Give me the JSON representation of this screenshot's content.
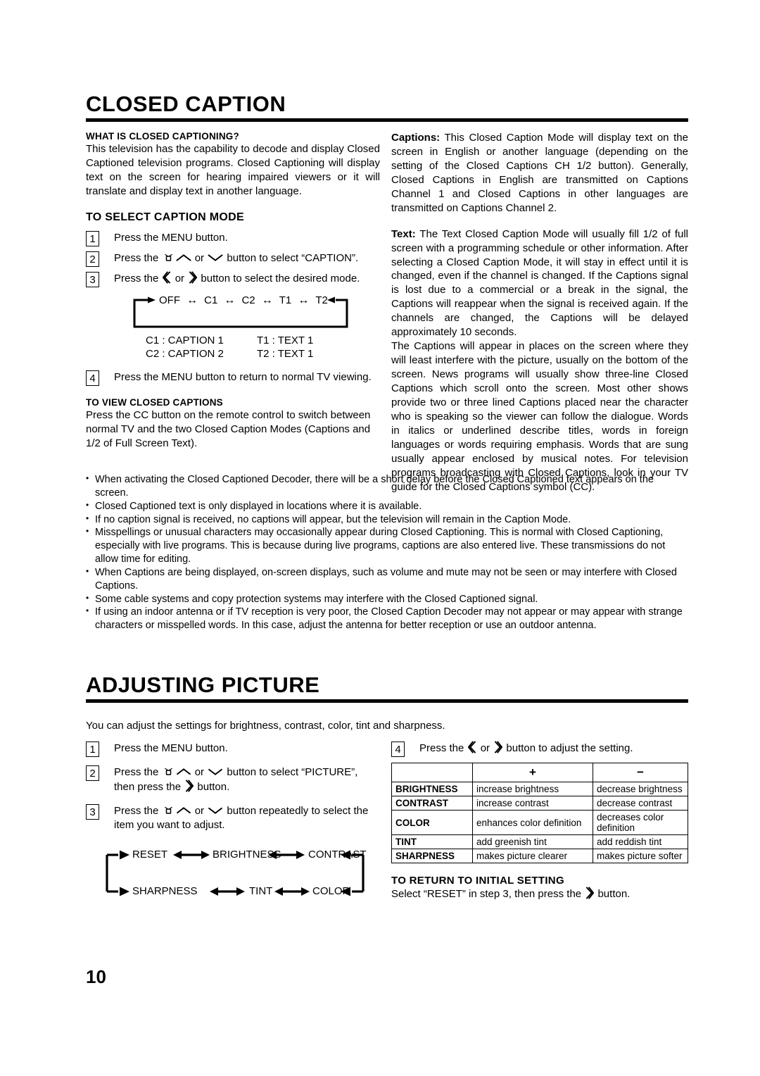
{
  "page": {
    "number": "10"
  },
  "closed_caption": {
    "title": "CLOSED CAPTION",
    "what_is": {
      "heading": "WHAT IS CLOSED CAPTIONING?",
      "body": "This television has the capability to decode and display Closed Captioned television programs. Closed Captioning will display text on the screen for hearing impaired viewers or it will translate and display text in another language."
    },
    "select_mode": {
      "heading": "TO SELECT CAPTION MODE",
      "steps": [
        {
          "num": "1",
          "text_before": "Press the MENU button.",
          "text_after": ""
        },
        {
          "num": "2",
          "text_before": "Press the ",
          "text_mid": " or ",
          "text_after": " button to select “CAPTION”."
        },
        {
          "num": "3",
          "text_before": "Press the ",
          "text_mid": " or ",
          "text_after": " button to select the desired mode."
        },
        {
          "num": "4",
          "text_before": "Press the MENU button to return to normal TV viewing.",
          "text_after": ""
        }
      ],
      "flow_items": [
        "OFF",
        "C1",
        "C2",
        "T1",
        "T2"
      ],
      "legend": [
        {
          "left": "C1  :  CAPTION 1",
          "right": "T1  :  TEXT 1"
        },
        {
          "left": "C2  :  CAPTION 2",
          "right": "T2  :  TEXT 1"
        }
      ]
    },
    "view_captions": {
      "heading": "TO VIEW CLOSED CAPTIONS",
      "body": "Press the CC button on the remote control to switch between normal TV and the two Closed Caption Modes (Captions and 1/2 of Full Screen Text)."
    },
    "captions_para": {
      "label": "Captions:",
      "body": " This Closed Caption Mode will display text on the screen in English or another language (depending on the setting of the Closed Captions CH 1/2 button). Generally, Closed Captions in English are transmitted on Captions Channel 1 and Closed Captions in other languages are transmitted on Captions Channel 2."
    },
    "text_para": {
      "label": "Text:",
      "body": " The Text Closed Caption Mode will usually fill 1/2 of full screen with a programming schedule or other information. After selecting a Closed Caption Mode, it will stay in effect until it is changed, even if the channel is changed. If the Captions signal is lost due to a commercial or a break in the signal, the Captions will reappear when the signal is received again. If the channels are changed, the Captions will be delayed approximately 10 seconds."
    },
    "captions_appear_para": "The Captions will appear in places on the screen where they will least interfere with the picture, usually on the bottom of the screen. News programs will usually show three-line Closed Captions which scroll onto the screen. Most other shows provide two or three lined Captions placed near the character who is speaking so the viewer can follow the dialogue. Words in italics or underlined describe titles, words in foreign languages or words requiring emphasis. Words that are sung usually appear enclosed by musical notes. For television programs broadcasting with Closed Captions, look in your TV guide for the Closed Captions symbol (CC).",
    "notes": [
      "When activating the Closed Captioned Decoder, there will be a short delay before the Closed Captioned text appears on the screen.",
      "Closed Captioned text is only displayed in locations where it is available.",
      "If no caption signal is received, no captions will appear, but the television will remain in the Caption Mode.",
      "Misspellings or unusual characters may occasionally appear during Closed Captioning. This is normal with Closed Captioning, especially with live programs. This is because during live programs, captions are also entered live. These transmissions do not allow time for editing.",
      "When Captions are being displayed, on-screen displays, such as volume and mute may not be seen or may interfere with Closed Captions.",
      "Some cable systems and copy protection systems may interfere with the Closed Captioned signal.",
      "If using an indoor antenna or if TV reception is very poor, the Closed Caption Decoder may not appear or may appear with strange characters or misspelled words. In this case, adjust the antenna for better reception or use an outdoor antenna."
    ]
  },
  "adjusting_picture": {
    "title": "ADJUSTING PICTURE",
    "intro": "You can adjust the settings for brightness, contrast, color, tint and sharpness.",
    "steps": [
      {
        "num": "1",
        "text_before": "Press the MENU button.",
        "text_after": ""
      },
      {
        "num": "2",
        "text_before": "Press the ",
        "text_mid": " or ",
        "text_after": " button to select “PICTURE”,",
        "line2_before": "then press the ",
        "line2_after": " button."
      },
      {
        "num": "3",
        "text_before": "Press the ",
        "text_mid": " or ",
        "text_after": " button repeatedly to select the",
        "line2": "item you want to adjust."
      },
      {
        "num": "4",
        "text_before": "Press the ",
        "text_mid": " or ",
        "text_after": " button to adjust the setting."
      }
    ],
    "flow": {
      "row1": [
        "RESET",
        "BRIGHTNESS",
        "CONTRAST"
      ],
      "row2": [
        "SHARPNESS",
        "TINT",
        "COLOR"
      ]
    },
    "table": {
      "headers": [
        "",
        "+",
        "−"
      ],
      "rows": [
        {
          "name": "BRIGHTNESS",
          "plus": "increase brightness",
          "minus": "decrease brightness"
        },
        {
          "name": "CONTRAST",
          "plus": "increase contrast",
          "minus": "decrease contrast"
        },
        {
          "name": "COLOR",
          "plus": "enhances color definition",
          "minus": "decreases color definition"
        },
        {
          "name": "TINT",
          "plus": "add greenish tint",
          "minus": "add reddish tint"
        },
        {
          "name": "SHARPNESS",
          "plus": "makes picture clearer",
          "minus": "makes picture softer"
        }
      ]
    },
    "reset": {
      "heading": "TO RETURN TO INITIAL SETTING",
      "text_before": "Select “RESET” in step 3, then press the ",
      "text_after": " button."
    }
  },
  "icons": {
    "tv": "tv-icon",
    "up": "chevron-up-icon",
    "down": "chevron-down-icon",
    "left": "chevron-left-icon",
    "right": "chevron-right-icon"
  }
}
